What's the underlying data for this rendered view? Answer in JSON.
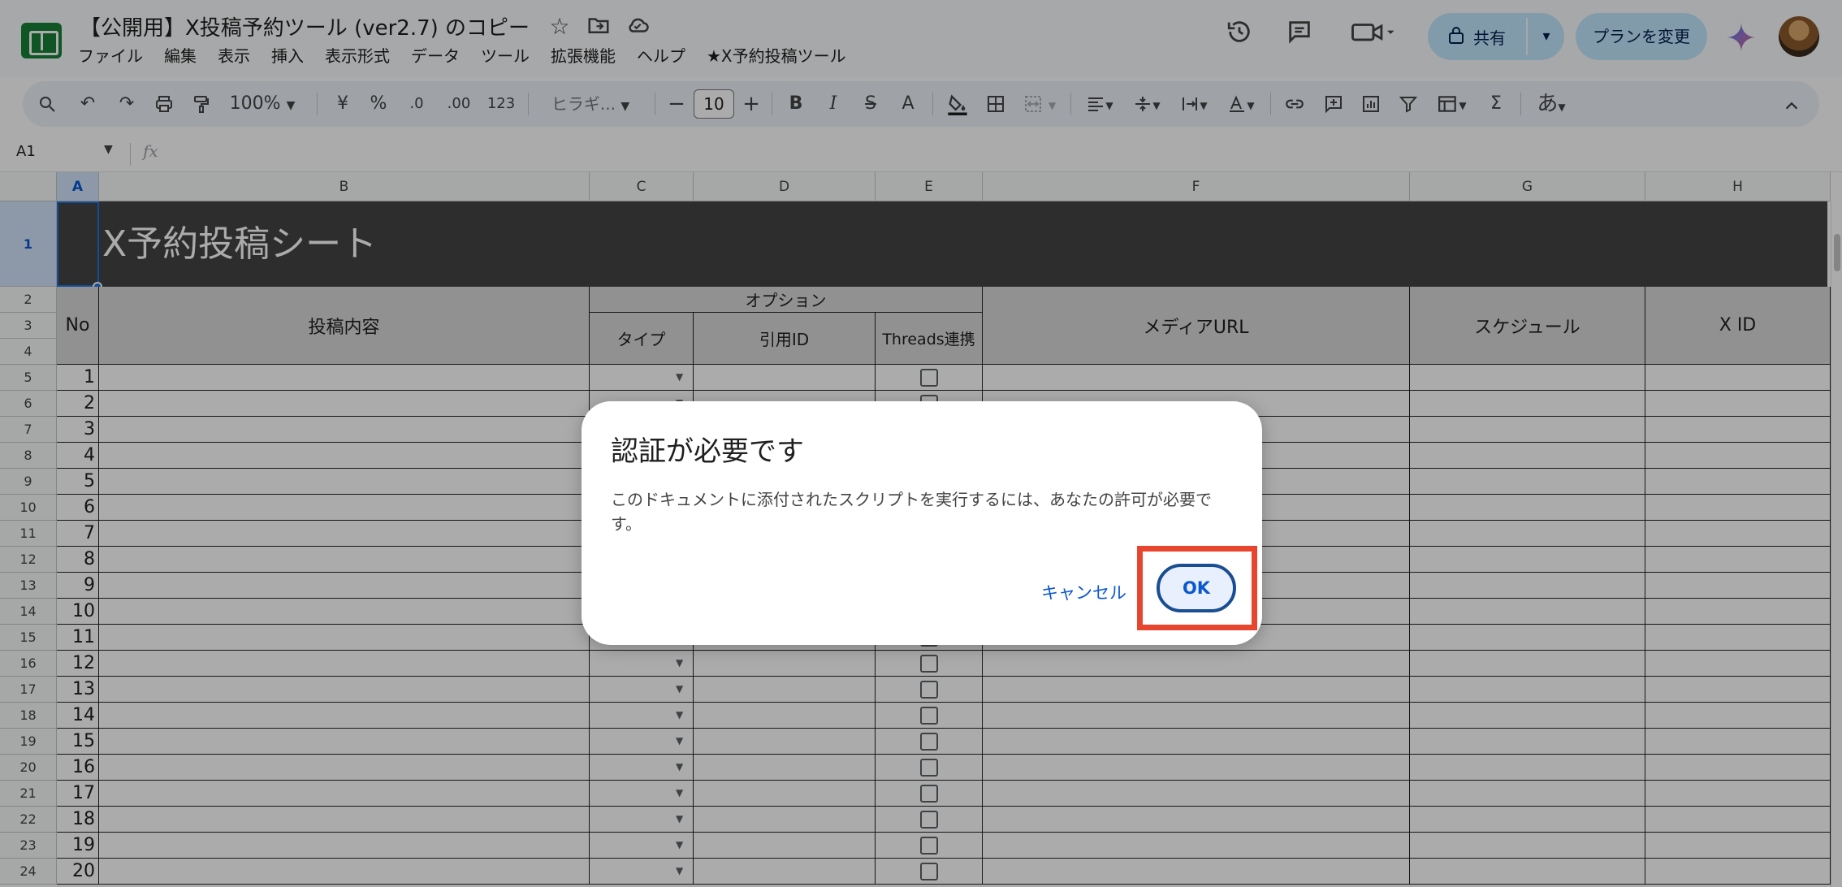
{
  "window": {
    "doc_title": "【公開用】X投稿予約ツール (ver2.7) のコピー"
  },
  "menu": [
    "ファイル",
    "編集",
    "表示",
    "挿入",
    "表示形式",
    "データ",
    "ツール",
    "拡張機能",
    "ヘルプ",
    "★X予約投稿ツール"
  ],
  "header_actions": {
    "share_label": "共有",
    "change_plan_label": "プランを変更"
  },
  "toolbar": {
    "zoom": "100%",
    "currency": "¥",
    "percent": "%",
    "decimal_decrease": ".0",
    "decimal_increase": ".00",
    "number_format": "123",
    "font": "ヒラギ...",
    "font_size": "10",
    "bold": "B",
    "italic": "I",
    "strike": "S",
    "text_color": "A",
    "sum": "Σ",
    "input_tool": "あ"
  },
  "formula_bar": {
    "name_box": "A1",
    "fx": "fx"
  },
  "sheet": {
    "columns": [
      "A",
      "B",
      "C",
      "D",
      "E",
      "F",
      "G",
      "H"
    ],
    "row_numbers": [
      "1",
      "2",
      "3",
      "4",
      "5",
      "6",
      "7",
      "8",
      "9",
      "10",
      "11",
      "12",
      "13",
      "14",
      "15",
      "16",
      "17",
      "18",
      "19",
      "20",
      "21",
      "22",
      "23",
      "24"
    ],
    "banner_title": "X予約投稿シート",
    "headers": {
      "no": "No",
      "content": "投稿内容",
      "options": "オプション",
      "type": "タイプ",
      "quote_id": "引用ID",
      "threads": "Threads連携",
      "media_url": "メディアURL",
      "schedule": "スケジュール",
      "x_id": "X ID"
    },
    "post_numbers": [
      "1",
      "2",
      "3",
      "4",
      "5",
      "6",
      "7",
      "8",
      "9",
      "10",
      "11",
      "12",
      "13",
      "14",
      "15",
      "16",
      "17",
      "18",
      "19",
      "20"
    ]
  },
  "dialog": {
    "title": "認証が必要です",
    "message": "このドキュメントに添付されたスクリプトを実行するには、あなたの許可が必要です。",
    "cancel_label": "キャンセル",
    "ok_label": "OK"
  },
  "colors": {
    "banner": "#434343",
    "header_fill": "#d9d9d9",
    "accent": "#0b57d0",
    "highlight": "#e8452f",
    "share_button": "#c2e7ff"
  }
}
